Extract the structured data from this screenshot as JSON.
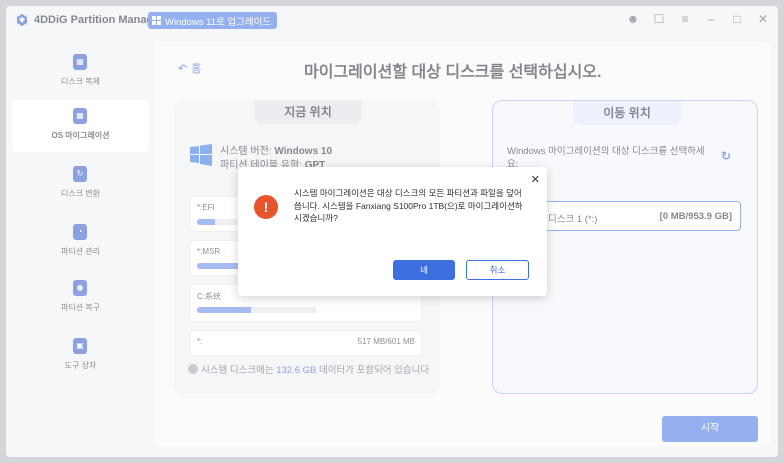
{
  "app": {
    "title": "4DDiG Partition Manager",
    "upgrade_label": "Windows 11로 업그레이드"
  },
  "titlebar_icons": [
    "user-icon",
    "feedback-icon",
    "menu-icon",
    "minimize-icon",
    "maximize-icon",
    "close-icon"
  ],
  "sidebar": {
    "items": [
      {
        "label": "디스크 복제",
        "icon": "clone-icon"
      },
      {
        "label": "OS 마이그레이션",
        "icon": "os-migration-icon",
        "active": true
      },
      {
        "label": "디스크 변환",
        "icon": "convert-icon"
      },
      {
        "label": "파티션 관리",
        "icon": "partition-icon"
      },
      {
        "label": "파티션 복구",
        "icon": "recovery-icon"
      },
      {
        "label": "도구 상자",
        "icon": "toolbox-icon"
      }
    ]
  },
  "main": {
    "back_label": "홈",
    "title": "마이그레이션할 대상 디스크를 선택하십시오.",
    "current": {
      "tab": "지금 위치",
      "sys_label": "시스템 버전: ",
      "sys_value": "Windows 10",
      "pt_label": "파티션 테이블 유형: ",
      "pt_value": "GPT",
      "partitions": [
        {
          "name": "*:EFI",
          "size": "",
          "used": 0.1
        },
        {
          "name": "*:MSR",
          "size": "",
          "used": 0.3
        },
        {
          "name": "C:系统",
          "size": "",
          "used": 0.45
        },
        {
          "name": "*:",
          "size": "517 MB/601 MB",
          "used": null
        }
      ],
      "note_prefix": "시스템 디스크에는 ",
      "note_highlight": "132.6 GB",
      "note_suffix": " 데이터가 포함되어 있습니다"
    },
    "target": {
      "tab": "이동 위치",
      "prompt": "Windows 마이그레이션의 대상 디스크를 선택하세요:",
      "disk_name": "디스크 1 (*:)",
      "disk_size": "[0 MB/953.9 GB]"
    },
    "start_label": "시작"
  },
  "dialog": {
    "message": "시스템 마이그레이션은 대상 디스크의 모든 파티션과 파일을 덮어씁니다. 시스템을 Fanxiang S100Pro 1TB(으)로 마이그레이션하시겠습니까?",
    "yes_label": "네",
    "cancel_label": "취소",
    "close": "✕"
  }
}
